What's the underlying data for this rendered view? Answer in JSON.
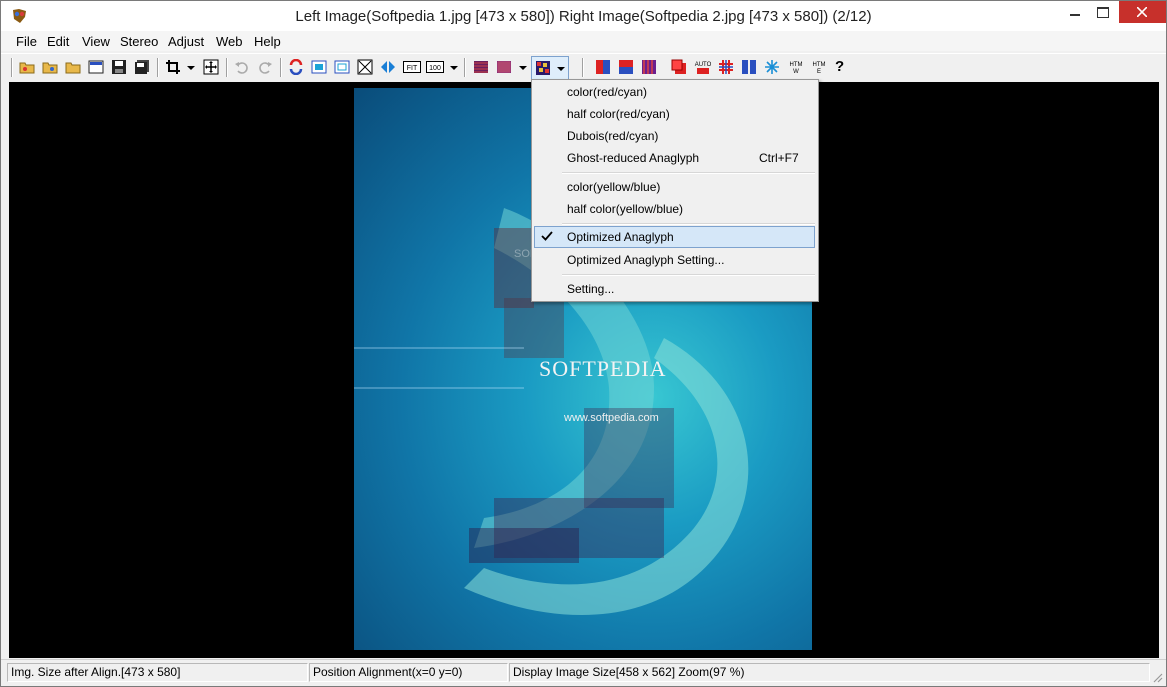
{
  "window": {
    "title": "Left Image(Softpedia 1.jpg [473 x 580]) Right Image(Softpedia 2.jpg [473 x 580])  (2/12)"
  },
  "menubar": {
    "items": [
      {
        "label": "File"
      },
      {
        "label": "Edit"
      },
      {
        "label": "View"
      },
      {
        "label": "Stereo"
      },
      {
        "label": "Adjust"
      },
      {
        "label": "Web"
      },
      {
        "label": "Help"
      }
    ]
  },
  "toolbar": {
    "icons": [
      "open-left-icon",
      "open-right-icon",
      "open-folder-icon",
      "open-pair-icon",
      "save-icon",
      "save-all-icon",
      "crop-icon",
      "align-icon",
      "undo-icon",
      "redo-icon",
      "swap-icon",
      "fit-window-icon",
      "frame-icon",
      "no-fit-icon",
      "mirror-icon",
      "fit-label-icon",
      "zoom-100-icon",
      "interlace-icon",
      "checker-icon",
      "anaglyph-icon",
      "side-by-side-icon",
      "above-below-icon",
      "column-icon",
      "glasses-icon",
      "red-icon",
      "auto-icon",
      "grid-icon",
      "split-icon",
      "snowflake-icon",
      "html-w-icon",
      "html-e-icon",
      "help-icon"
    ],
    "fit_label": "FIT",
    "zoom_label": "100",
    "html_w_label": "HTM\nW",
    "html_e_label": "HTM\nE",
    "help_label": "?",
    "auto_label": "AUTO"
  },
  "dropdown": {
    "items": [
      {
        "label": "color(red/cyan)"
      },
      {
        "label": "half color(red/cyan)"
      },
      {
        "label": "Dubois(red/cyan)"
      },
      {
        "label": "Ghost-reduced Anaglyph",
        "shortcut": "Ctrl+F7"
      },
      {
        "label": "color(yellow/blue)"
      },
      {
        "label": "half color(yellow/blue)"
      },
      {
        "label": "Optimized Anaglyph",
        "checked": true
      },
      {
        "label": "Optimized Anaglyph Setting..."
      },
      {
        "label": "Setting..."
      }
    ]
  },
  "image": {
    "watermark_main": "SOFTPEDIA",
    "watermark_url": "www.softpedia.com",
    "watermark_faint": "SOFTPEDIA"
  },
  "statusbar": {
    "img_size": "Img. Size after Align.[473 x 580]",
    "position": "Position Alignment(x=0 y=0)",
    "display": "Display Image Size[458 x 562]  Zoom(97 %)"
  },
  "colors": {
    "close_button": "#c7302b",
    "selection_bg": "#d5e7f8",
    "selection_border": "#7da2ce",
    "viewport_bg": "#000000"
  }
}
